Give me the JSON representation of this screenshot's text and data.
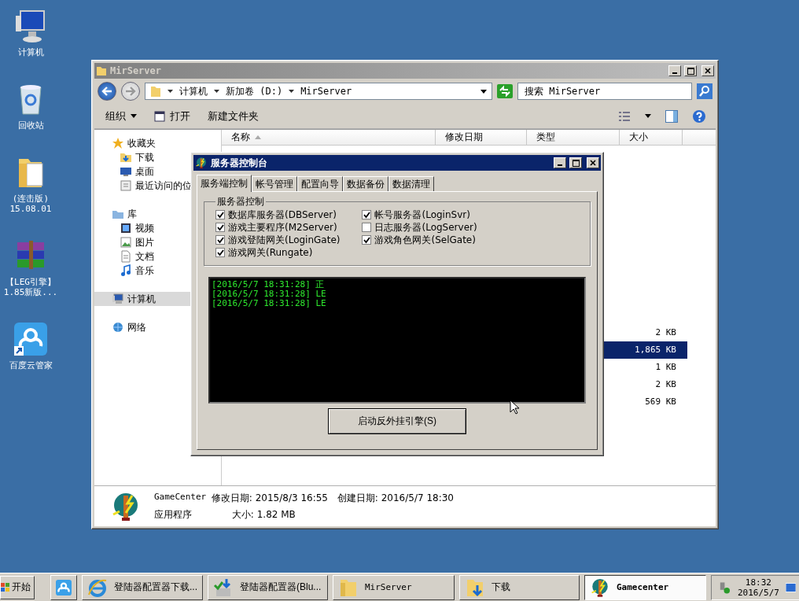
{
  "desktop_icons": [
    {
      "kind": "computer",
      "lines": [
        "计算机"
      ]
    },
    {
      "kind": "recycle",
      "lines": [
        "回收站"
      ]
    },
    {
      "kind": "folder",
      "lines": [
        "(连击版)",
        "15.08.01"
      ]
    },
    {
      "kind": "archive",
      "lines": [
        "【LEG引擎】",
        "1.85新版..."
      ]
    },
    {
      "kind": "cloud",
      "lines": [
        "百度云管家"
      ]
    }
  ],
  "explorer": {
    "title": "MirServer",
    "breadcrumb": [
      "计算机",
      "新加卷 (D:)",
      "MirServer"
    ],
    "search": {
      "placeholder": "搜索 MirServer"
    },
    "toolbar": [
      {
        "kind": "menu",
        "label": "组织"
      },
      {
        "kind": "open",
        "label": "打开"
      },
      {
        "kind": "plain",
        "label": "新建文件夹"
      }
    ],
    "nav": [
      {
        "kind": "star",
        "label": "收藏夹",
        "selected": false,
        "children": [
          {
            "kind": "download",
            "label": "下载",
            "selected": false
          },
          {
            "kind": "desktop",
            "label": "桌面",
            "selected": false
          },
          {
            "kind": "recent",
            "label": "最近访问的位",
            "selected": false
          }
        ]
      },
      {
        "kind": "library",
        "label": "库",
        "selected": false,
        "children": [
          {
            "kind": "video",
            "label": "视频",
            "selected": false
          },
          {
            "kind": "picture",
            "label": "图片",
            "selected": false
          },
          {
            "kind": "document",
            "label": "文档",
            "selected": false
          },
          {
            "kind": "music",
            "label": "音乐",
            "selected": false
          }
        ]
      },
      {
        "kind": "computer",
        "label": "计算机",
        "selected": true
      },
      {
        "kind": "network",
        "label": "网络",
        "selected": false
      }
    ],
    "columns": [
      {
        "label": "名称",
        "sorted": true
      },
      {
        "label": "修改日期",
        "sorted": false
      },
      {
        "label": "类型",
        "sorted": false
      },
      {
        "label": "大小",
        "sorted": false
      }
    ],
    "rows": [
      {
        "size": "2 KB",
        "selected": false
      },
      {
        "size": "1,865 KB",
        "selected": true
      },
      {
        "size": "1 KB",
        "selected": false
      },
      {
        "size": "2 KB",
        "selected": false
      },
      {
        "size": "569 KB",
        "selected": false
      }
    ],
    "details": {
      "name": "GameCenter",
      "modified": "修改日期: 2015/8/3 16:55",
      "created": "创建日期: 2016/5/7 18:30",
      "type": "应用程序",
      "size": "大小: 1.82 MB"
    }
  },
  "dialog": {
    "title": "服务器控制台",
    "tabs": [
      {
        "label": "服务端控制",
        "selected": true
      },
      {
        "label": "帐号管理",
        "selected": false
      },
      {
        "label": "配置向导",
        "selected": false
      },
      {
        "label": "数据备份",
        "selected": false
      },
      {
        "label": "数据清理",
        "selected": false
      }
    ],
    "group_title": "服务器控制",
    "checks_left": [
      {
        "label": "数据库服务器(DBServer)",
        "checked": true
      },
      {
        "label": "游戏主要程序(M2Server)",
        "checked": true
      },
      {
        "label": "游戏登陆网关(LoginGate)",
        "checked": true
      },
      {
        "label": "游戏网关(Rungate)",
        "checked": true
      }
    ],
    "checks_right": [
      {
        "label": "帐号服务器(LoginSvr)",
        "checked": true
      },
      {
        "label": "日志服务器(LogServer)",
        "checked": false
      },
      {
        "label": "游戏角色网关(SelGate)",
        "checked": true
      }
    ],
    "log": [
      "[2016/5/7 18:31:28] 正",
      "[2016/5/7 18:31:28] LE",
      "[2016/5/7 18:31:28] LE"
    ],
    "button": "启动反外挂引擎(S)"
  },
  "taskbar": {
    "start": "开始",
    "tasks": [
      {
        "kind": "cloud",
        "selected": false
      },
      {
        "kind": "browser",
        "label": "登陆器配置器下载...",
        "selected": false
      },
      {
        "kind": "installer",
        "label": "登陆器配置器(Blu...",
        "selected": false
      },
      {
        "kind": "folder",
        "label": "MirServer",
        "selected": false
      },
      {
        "kind": "download",
        "label": "下载",
        "selected": false
      },
      {
        "kind": "app",
        "label": "Gamecenter",
        "selected": true
      }
    ],
    "time": "18:32",
    "date": "2016/5/7"
  }
}
